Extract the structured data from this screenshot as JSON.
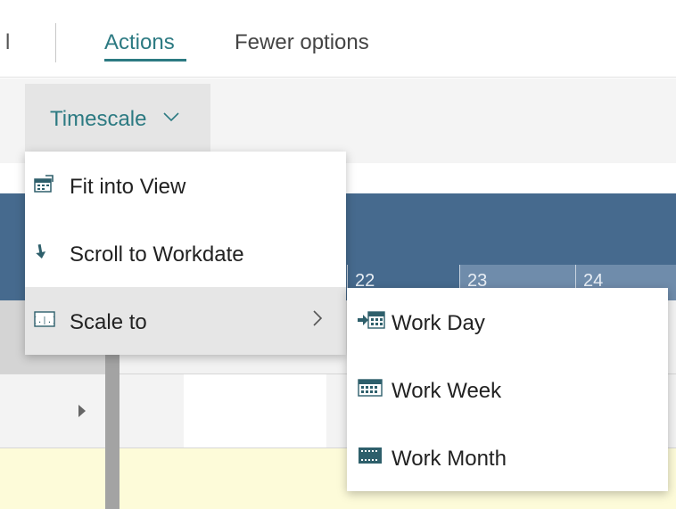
{
  "tabs": {
    "previous": "l",
    "actions": "Actions",
    "fewer_options": "Fewer options"
  },
  "toolbar": {
    "timescale_label": "Timescale",
    "timescale_chevron": "chevron-down-icon"
  },
  "gantt": {
    "dates": [
      "22",
      "23",
      "24"
    ],
    "colors": {
      "header": "#466a8e",
      "date_cell": "#6f8cab",
      "row_highlight": "#fdfbd9"
    }
  },
  "menu": {
    "items": [
      {
        "label": "Fit into View",
        "icon": "fit-view-icon"
      },
      {
        "label": "Scroll to Workdate",
        "icon": "scroll-arrow-icon"
      },
      {
        "label": "Scale to",
        "icon": "scale-to-icon",
        "has_submenu": true
      }
    ]
  },
  "submenu": {
    "items": [
      {
        "label": "Work Day",
        "icon": "work-day-icon"
      },
      {
        "label": "Work Week",
        "icon": "work-week-icon"
      },
      {
        "label": "Work Month",
        "icon": "work-month-icon"
      }
    ]
  },
  "accent_color": "#2c7a82"
}
